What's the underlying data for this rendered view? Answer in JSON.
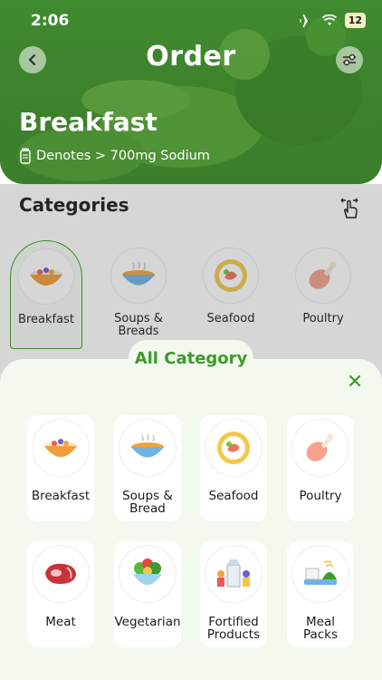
{
  "status": {
    "time": "2:06",
    "battery": "12"
  },
  "header": {
    "title": "Order",
    "section": "Breakfast",
    "sodium_note": "Denotes > 700mg Sodium"
  },
  "categories": {
    "heading": "Categories",
    "items": [
      {
        "label": "Breakfast",
        "icon": "bowl-icon",
        "selected": true
      },
      {
        "label": "Soups & Breads",
        "icon": "soup-icon",
        "selected": false
      },
      {
        "label": "Seafood",
        "icon": "shrimp-plate-icon",
        "selected": false
      },
      {
        "label": "Poultry",
        "icon": "drumstick-icon",
        "selected": false
      }
    ]
  },
  "sheet": {
    "title": "All Category",
    "items": [
      {
        "label": "Breakfast",
        "icon": "bowl-icon"
      },
      {
        "label": "Soups & Bread",
        "icon": "soup-icon"
      },
      {
        "label": "Seafood",
        "icon": "shrimp-plate-icon"
      },
      {
        "label": "Poultry",
        "icon": "drumstick-icon"
      },
      {
        "label": "Meat",
        "icon": "steak-icon"
      },
      {
        "label": "Vegetarian",
        "icon": "salad-icon"
      },
      {
        "label": "Fortified Products",
        "icon": "milk-carton-icon"
      },
      {
        "label": "Meal Packs",
        "icon": "meal-pack-icon"
      }
    ]
  },
  "colors": {
    "brand_green": "#3e9a2a",
    "sheet_bg": "#f3f9ef"
  }
}
